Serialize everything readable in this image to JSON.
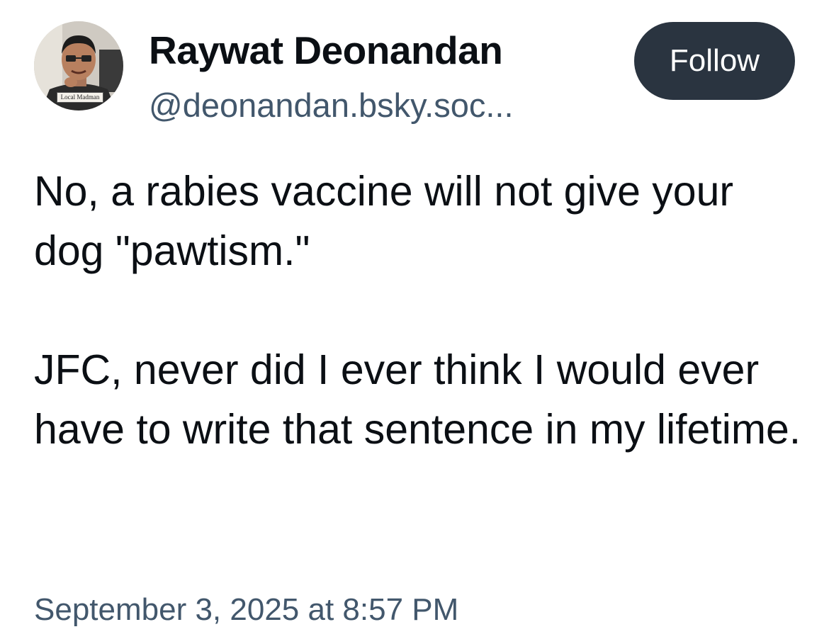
{
  "author": {
    "display_name": "Raywat Deonandan",
    "handle": "@deonandan.bsky.soc...",
    "avatar_badge_text": "Local Madman",
    "avatar_icon": "profile-photo"
  },
  "follow_button": {
    "label": "Follow",
    "color": "#2a3440"
  },
  "post": {
    "paragraphs": [
      "No, a rabies vaccine will not give your dog \"pawtism.\"",
      "JFC, never did I ever think I would ever have to write that sentence in my lifetime."
    ],
    "timestamp": "September 3, 2025 at 8:57 PM"
  },
  "colors": {
    "text_primary": "#0b0f14",
    "text_secondary": "#42576c",
    "background": "#ffffff"
  }
}
